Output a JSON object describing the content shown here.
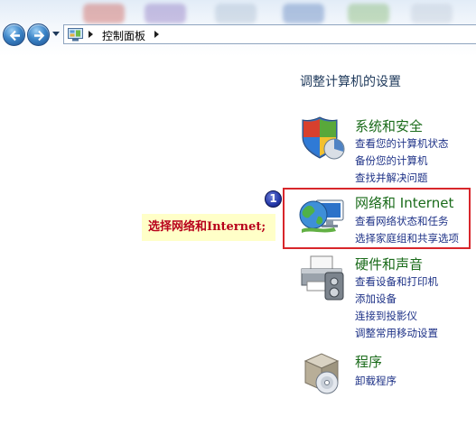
{
  "address_bar": {
    "breadcrumb": "控制面板"
  },
  "content": {
    "heading": "调整计算机的设置",
    "categories": [
      {
        "title": "系统和安全",
        "links": [
          "查看您的计算机状态",
          "备份您的计算机",
          "查找并解决问题"
        ]
      },
      {
        "title": "网络和 Internet",
        "links": [
          "查看网络状态和任务",
          "选择家庭组和共享选项"
        ]
      },
      {
        "title": "硬件和声音",
        "links": [
          "查看设备和打印机",
          "添加设备",
          "连接到投影仪",
          "调整常用移动设置"
        ]
      },
      {
        "title": "程序",
        "links": [
          "卸载程序"
        ]
      }
    ]
  },
  "annotation": {
    "step_number": "1",
    "label": "选择网络和Internet;"
  },
  "colors": {
    "category_title": "#1a6b1a",
    "link": "#1e3287",
    "highlight_border": "#d8262b",
    "annotation_bg": "#ffffc8",
    "annotation_text": "#b8001b"
  },
  "icons": {
    "back": "back-arrow-icon",
    "forward": "forward-arrow-icon",
    "control_panel": "control-panel-icon",
    "security": "shield-icon",
    "network": "globe-monitor-icon",
    "hardware": "printer-icon",
    "programs": "program-box-icon"
  }
}
